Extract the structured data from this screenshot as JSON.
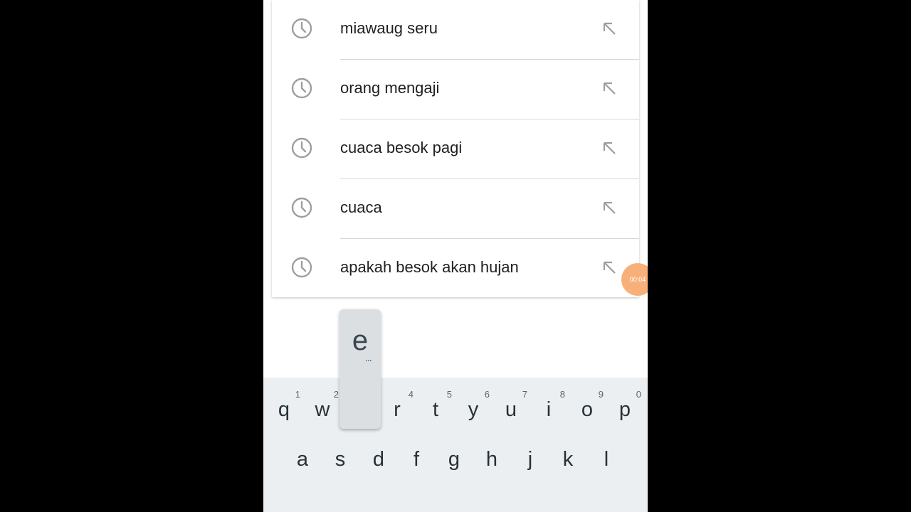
{
  "suggestions": [
    {
      "text": "miawaug seru"
    },
    {
      "text": "orang mengaji"
    },
    {
      "text": "cuaca besok pagi"
    },
    {
      "text": "cuaca"
    },
    {
      "text": "apakah besok akan hujan"
    }
  ],
  "icons": {
    "history": "clock-icon",
    "fill_query": "arrow-up-left-icon"
  },
  "timer_badge": "00:04",
  "keyboard": {
    "row1": [
      {
        "key": "q",
        "hint": "1"
      },
      {
        "key": "w",
        "hint": "2"
      },
      {
        "key": "r",
        "hint": "4"
      },
      {
        "key": "t",
        "hint": "5"
      },
      {
        "key": "y",
        "hint": "6"
      },
      {
        "key": "u",
        "hint": "7"
      },
      {
        "key": "i",
        "hint": "8"
      },
      {
        "key": "o",
        "hint": "9"
      },
      {
        "key": "p",
        "hint": "0"
      }
    ],
    "row2": [
      "a",
      "s",
      "d",
      "f",
      "g",
      "h",
      "j",
      "k",
      "l"
    ],
    "popup": {
      "key": "e",
      "more": "..."
    }
  },
  "colors": {
    "keyboard_bg": "#eceff1",
    "timer_badge": "#f8b07a",
    "icon_gray": "#9e9e9e"
  }
}
